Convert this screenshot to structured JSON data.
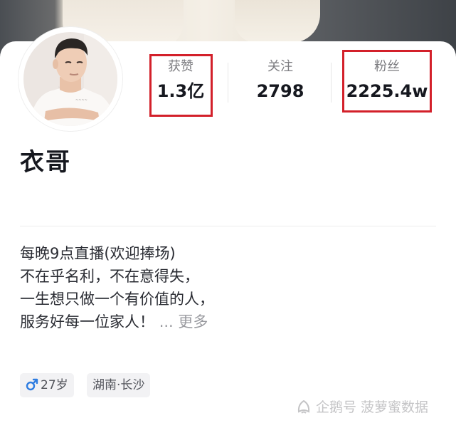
{
  "profile": {
    "nickname": "衣哥",
    "stats": [
      {
        "label": "获赞",
        "value": "1.3亿"
      },
      {
        "label": "关注",
        "value": "2798"
      },
      {
        "label": "粉丝",
        "value": "2225.4w"
      }
    ],
    "bio": [
      "每晚9点直播(欢迎捧场)",
      "不在乎名利，不在意得失，",
      "一生想只做一个有价值的人，",
      "服务好每一位家人！"
    ],
    "bio_ellipsis": "...",
    "more_label": "更多",
    "tags": {
      "gender_icon": "male-icon",
      "age": "27岁",
      "location": "湖南·长沙"
    }
  },
  "watermark": {
    "icon": "penguin-icon",
    "text": "企鹅号 菠萝蜜数据"
  },
  "colors": {
    "highlight_box": "#d3202a",
    "male_icon": "#2f7de1",
    "stat_label": "#7c7c80",
    "text_primary": "#16181f"
  }
}
